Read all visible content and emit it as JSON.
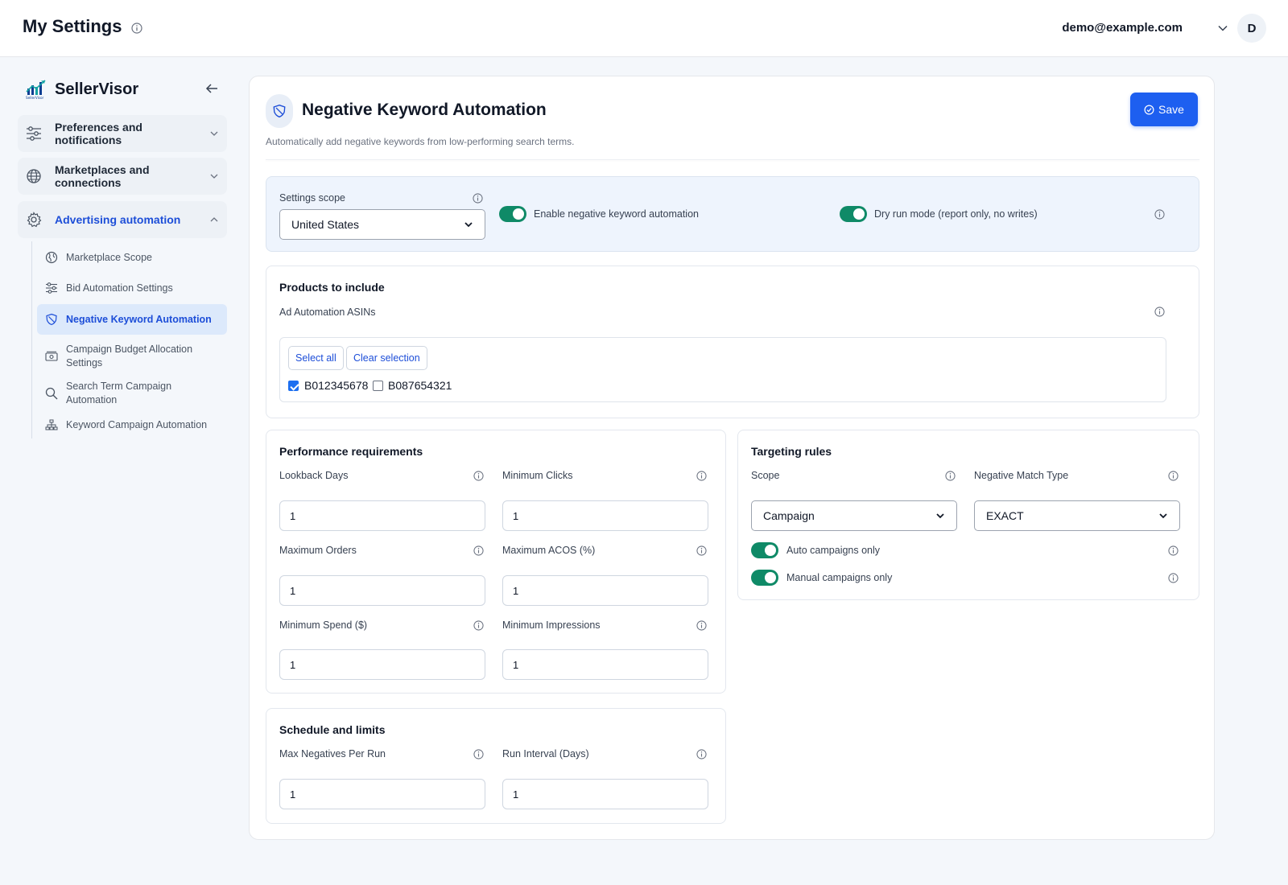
{
  "header": {
    "title": "My Settings",
    "user_email": "demo@example.com",
    "avatar_initial": "D"
  },
  "sidebar": {
    "brand_name": "SellerVisor",
    "groups": [
      {
        "label": "Preferences and notifications",
        "icon": "sliders-icon",
        "expanded": false
      },
      {
        "label": "Marketplaces and connections",
        "icon": "globe-icon",
        "expanded": false
      },
      {
        "label": "Advertising automation",
        "icon": "gear-icon",
        "expanded": true
      }
    ],
    "sub_items": [
      {
        "label": "Marketplace Scope",
        "icon": "globe-icon"
      },
      {
        "label": "Bid Automation Settings",
        "icon": "sliders-icon"
      },
      {
        "label": "Negative Keyword Automation",
        "icon": "shield-icon",
        "active": true
      },
      {
        "label": "Campaign Budget Allocation Settings",
        "icon": "money-icon"
      },
      {
        "label": "Search Term Campaign Automation",
        "icon": "search-icon"
      },
      {
        "label": "Keyword Campaign Automation",
        "icon": "sitemap-icon"
      }
    ]
  },
  "page": {
    "title": "Negative Keyword Automation",
    "description": "Automatically add negative keywords from low-performing search terms.",
    "save_label": "Save"
  },
  "scope_panel": {
    "settings_scope_label": "Settings scope",
    "settings_scope_value": "United States",
    "enable_label": "Enable negative keyword automation",
    "enable_on": true,
    "dry_run_label": "Dry run mode (report only, no writes)",
    "dry_run_on": true
  },
  "products": {
    "title": "Products to include",
    "asins_label": "Ad Automation ASINs",
    "select_all": "Select all",
    "clear_selection": "Clear selection",
    "asins": [
      {
        "value": "B012345678",
        "checked": true
      },
      {
        "value": "B087654321",
        "checked": false
      }
    ]
  },
  "performance": {
    "title": "Performance requirements",
    "fields": [
      {
        "label": "Lookback Days",
        "value": "1"
      },
      {
        "label": "Minimum Clicks",
        "value": "1"
      },
      {
        "label": "Maximum Orders",
        "value": "1"
      },
      {
        "label": "Maximum ACOS (%)",
        "value": "1"
      },
      {
        "label": "Minimum Spend ($)",
        "value": "1"
      },
      {
        "label": "Minimum Impressions",
        "value": "1"
      }
    ]
  },
  "targeting": {
    "title": "Targeting rules",
    "scope_label": "Scope",
    "scope_value": "Campaign",
    "match_type_label": "Negative Match Type",
    "match_type_value": "EXACT",
    "auto_label": "Auto campaigns only",
    "auto_on": true,
    "manual_label": "Manual campaigns only",
    "manual_on": true
  },
  "schedule": {
    "title": "Schedule and limits",
    "fields": [
      {
        "label": "Max Negatives Per Run",
        "value": "1"
      },
      {
        "label": "Run Interval (Days)",
        "value": "1"
      }
    ]
  },
  "colors": {
    "primary": "#1d5ff0",
    "toggle_on": "#0f8a67",
    "active_nav_bg": "#dce9fb",
    "active_nav_text": "#1d4ed8"
  }
}
